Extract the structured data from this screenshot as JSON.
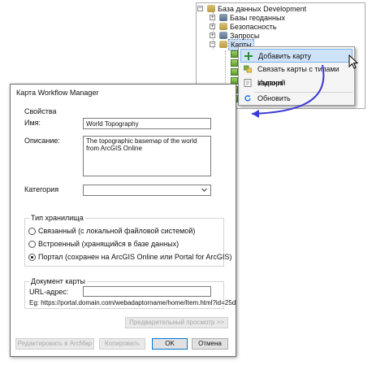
{
  "tree": {
    "root_label": "База данных Development",
    "items": [
      {
        "label": "Базы геоданных"
      },
      {
        "label": "Безопасность"
      },
      {
        "label": "Запросы"
      },
      {
        "label": "Карты"
      }
    ]
  },
  "context_menu": {
    "items": [
      {
        "label": "Добавить карту",
        "icon": "plus-icon",
        "color": "#2e8b2e"
      },
      {
        "label": "Связать карты с типами заданий",
        "icon": "link-maps-icon"
      },
      {
        "label": "Импорт",
        "icon": "import-icon"
      },
      {
        "label": "Обновить",
        "icon": "refresh-icon",
        "color": "#1e6fd0"
      }
    ]
  },
  "arrow_color": "#3a3ad6",
  "dialog": {
    "title": "Карта Workflow Manager",
    "properties_label": "Свойства",
    "name_label": "Имя:",
    "name_value": "World Topography",
    "description_label": "Описание:",
    "description_value": "The topographic basemap of the world from ArcGIS Online",
    "category_label": "Категория",
    "category_value": "",
    "storage": {
      "label": "Тип хранилища",
      "options": [
        {
          "label": "Связанный (с локальной файловой системой)",
          "selected": false
        },
        {
          "label": "Встроенный (хранящийся в базе данных)",
          "selected": false
        },
        {
          "label": "Портал (сохранен на ArcGIS Online или Portal for ArcGIS)",
          "selected": true
        }
      ]
    },
    "document": {
      "label": "Документ карты",
      "url_label": "URL-адрес:",
      "url_value": "",
      "example": "Eg:  https://portal.domain.com/webadaptorname/home/Item.html?id=25d"
    },
    "buttons": {
      "preview": "Предварительный просмотр >>",
      "edit_arcmap": "Редактировать в ArcMap",
      "copy": "Копировать",
      "ok": "OK",
      "cancel": "Отмена"
    }
  }
}
